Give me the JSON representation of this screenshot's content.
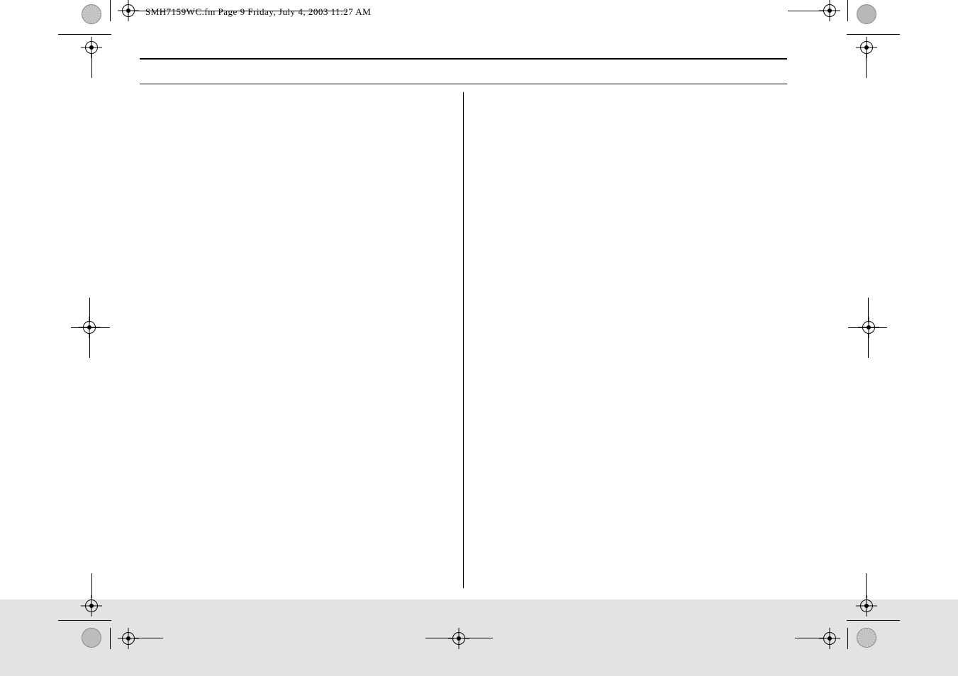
{
  "header": {
    "text": "SMH7159WC.fm  Page 9  Friday, July 4, 2003  11:27 AM"
  }
}
